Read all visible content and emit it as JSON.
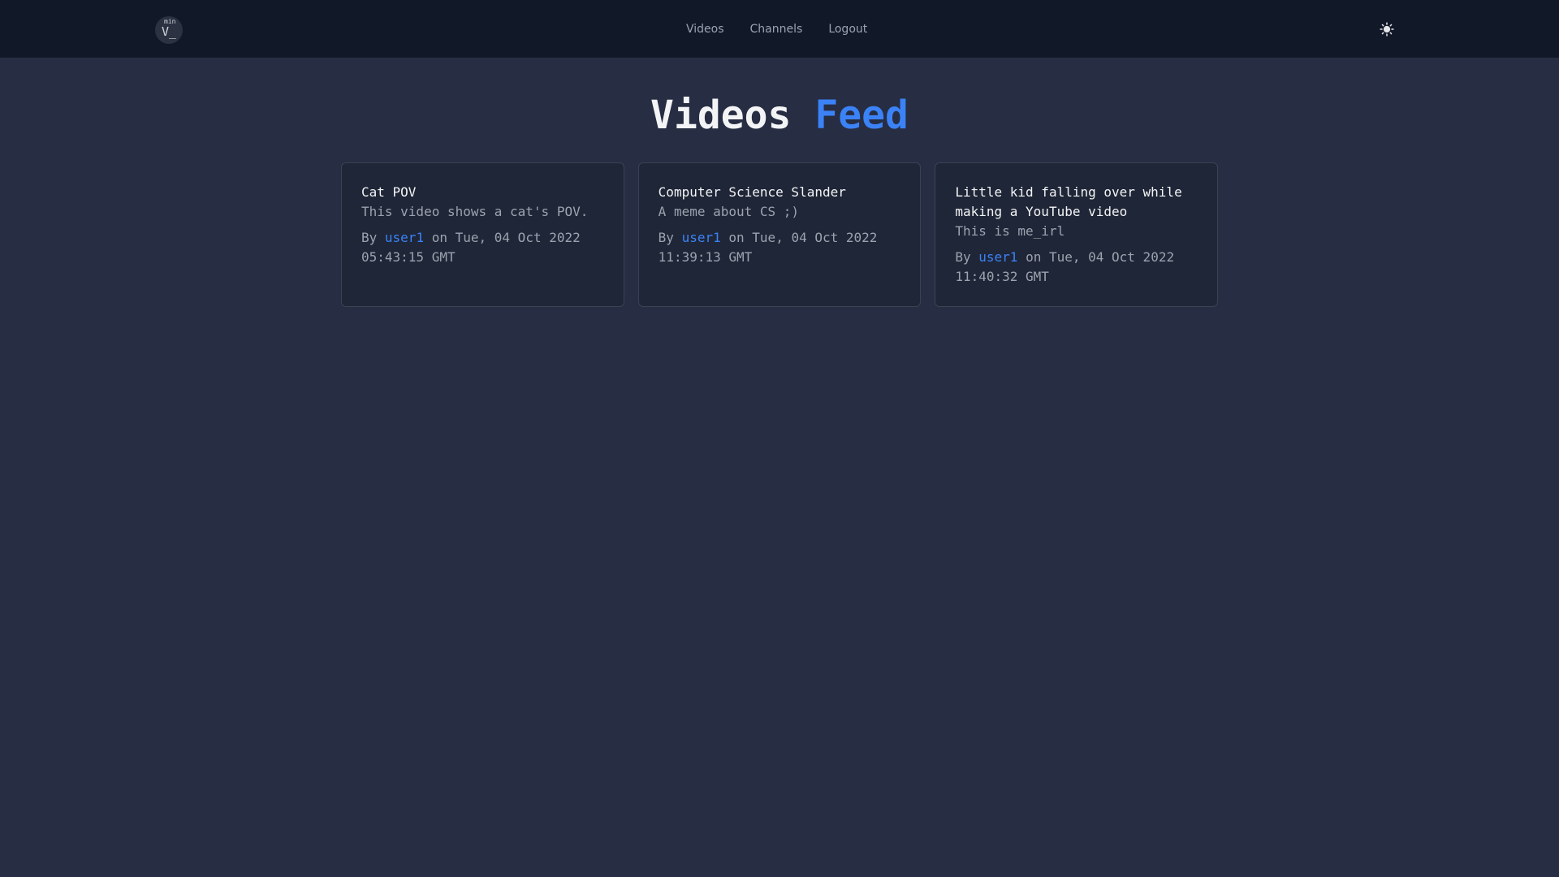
{
  "logo": {
    "sup": "min",
    "main": "V_"
  },
  "nav": {
    "links": [
      "Videos",
      "Channels",
      "Logout"
    ]
  },
  "title": {
    "main": "Videos",
    "accent": "Feed"
  },
  "videos": [
    {
      "title": "Cat POV",
      "description": "This video shows a cat's POV.",
      "by": "By",
      "author": "user1",
      "on": "on Tue, 04 Oct 2022 05:43:15 GMT"
    },
    {
      "title": "Computer Science Slander",
      "description": "A meme about CS ;)",
      "by": "By",
      "author": "user1",
      "on": "on Tue, 04 Oct 2022 11:39:13 GMT"
    },
    {
      "title": "Little kid falling over while making a YouTube video",
      "description": "This is me_irl",
      "by": "By",
      "author": "user1",
      "on": "on Tue, 04 Oct 2022 11:40:32 GMT"
    }
  ],
  "colors": {
    "accent": "#3b82f6",
    "navbar": "#111827",
    "background": "#272d42",
    "card": "#1f2637"
  },
  "icons": {
    "theme_toggle": "sun-icon"
  }
}
